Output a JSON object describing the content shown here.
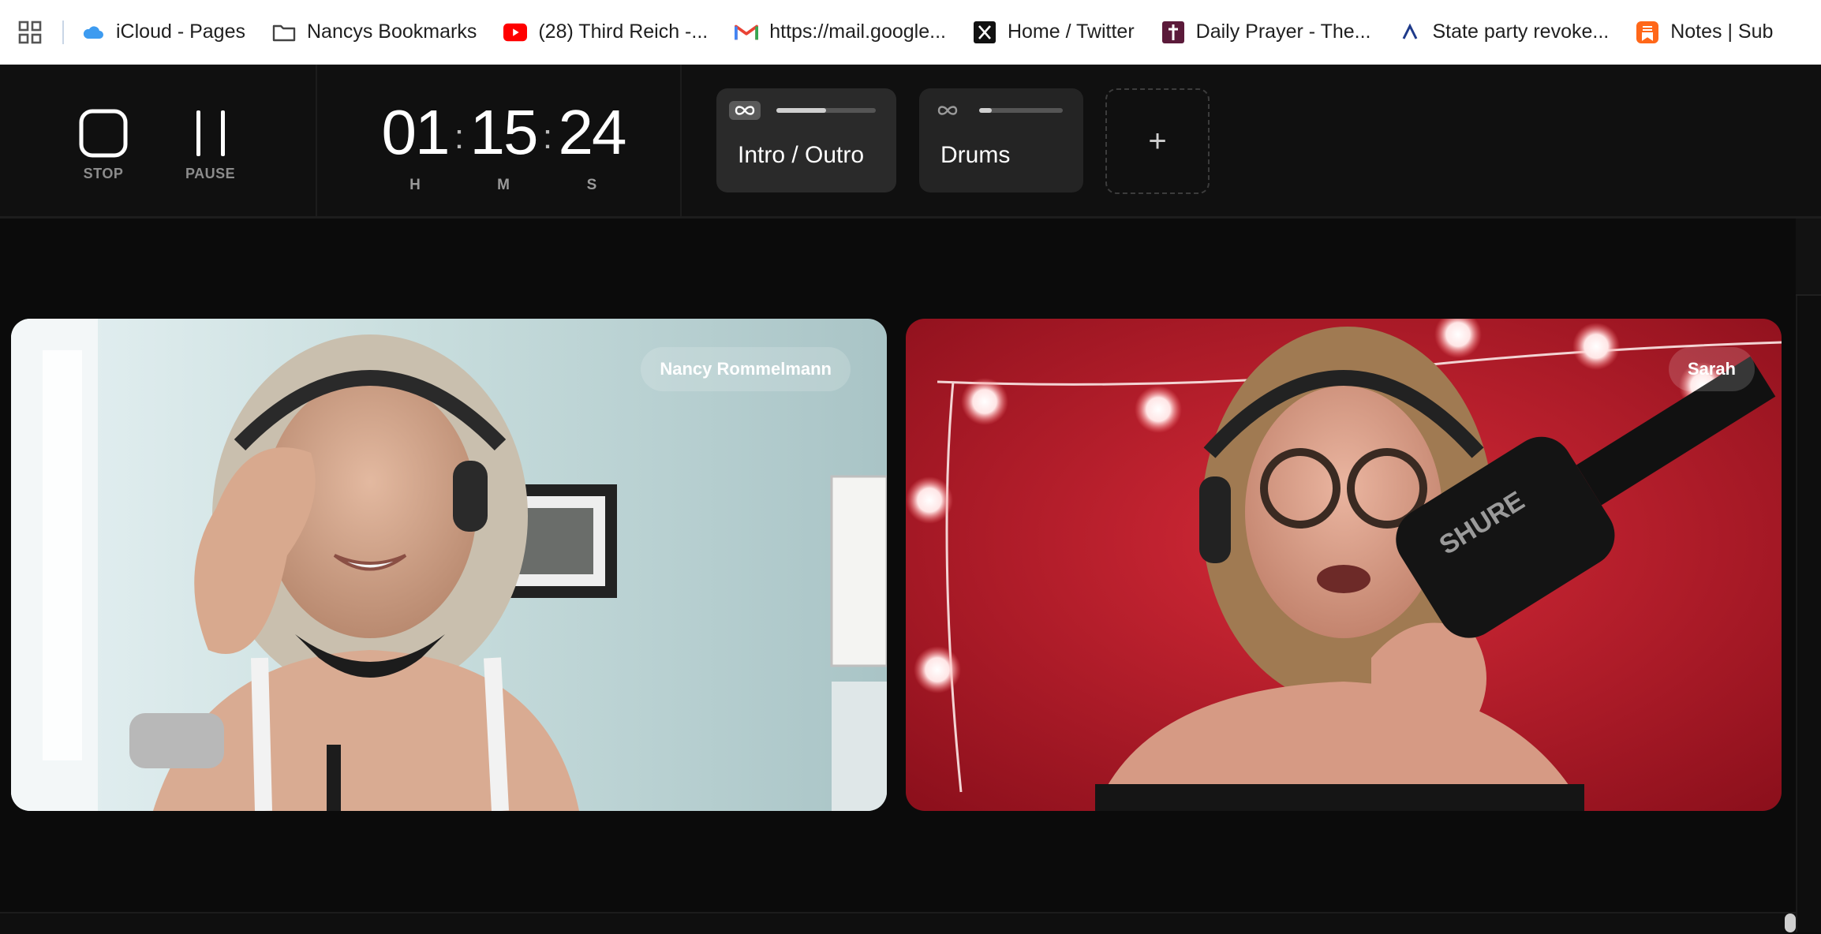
{
  "bookmarks": [
    {
      "label": "iCloud - Pages",
      "icon": "icloud-icon"
    },
    {
      "label": "Nancys Bookmarks",
      "icon": "folder-icon"
    },
    {
      "label": "(28) Third Reich -...",
      "icon": "youtube-icon"
    },
    {
      "label": "https://mail.google...",
      "icon": "gmail-icon"
    },
    {
      "label": "Home / Twitter",
      "icon": "x-logo-icon"
    },
    {
      "label": "Daily Prayer - The...",
      "icon": "cross-icon"
    },
    {
      "label": "State party revoke...",
      "icon": "news-icon"
    },
    {
      "label": "Notes | Sub",
      "icon": "substack-icon"
    }
  ],
  "controls": {
    "stop_label": "STOP",
    "pause_label": "PAUSE"
  },
  "timer": {
    "hours": "01",
    "minutes": "15",
    "seconds": "24",
    "h_label": "H",
    "m_label": "M",
    "s_label": "S",
    "separator": ":"
  },
  "tracks": [
    {
      "name": "Intro / Outro",
      "progress": 0.5,
      "active": true
    },
    {
      "name": "Drums",
      "progress": 0.15,
      "active": false
    }
  ],
  "add_track_symbol": "+",
  "participants": [
    {
      "name": "Nancy Rommelmann"
    },
    {
      "name": "Sarah"
    }
  ],
  "colors": {
    "background": "#0b0b0b",
    "panel": "#101010",
    "track_card": "#242424",
    "sarah_backdrop": "#c8192b"
  }
}
